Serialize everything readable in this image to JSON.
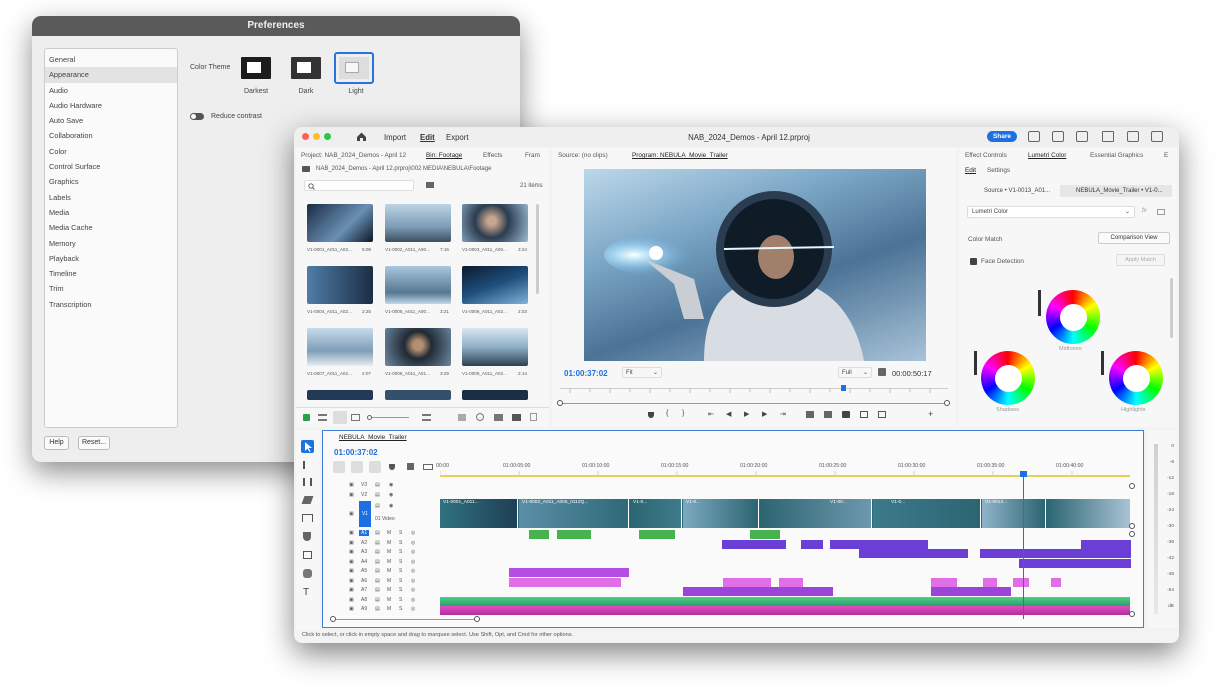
{
  "prefs": {
    "title": "Preferences",
    "categories": [
      "General",
      "Appearance",
      "Audio",
      "Audio Hardware",
      "Auto Save",
      "Collaboration",
      "Color",
      "Control Surface",
      "Graphics",
      "Labels",
      "Media",
      "Media Cache",
      "Memory",
      "Playback",
      "Timeline",
      "Trim",
      "Transcription"
    ],
    "selected": "Appearance",
    "color_theme_label": "Color Theme",
    "themes": [
      "Darkest",
      "Dark",
      "Light"
    ],
    "selected_theme": "Light",
    "reduce_contrast_label": "Reduce contrast",
    "help_label": "Help",
    "reset_label": "Reset..."
  },
  "menu": {
    "import": "Import",
    "edit": "Edit",
    "export": "Export"
  },
  "window_title": "NAB_2024_Demos - April 12.prproj",
  "share_label": "Share",
  "project": {
    "tabs": [
      "Project: NAB_2024_Demos - April 12",
      "Bin: Footage",
      "Effects",
      "Fram"
    ],
    "path": "NAB_2024_Demos - April 12.prproj\\002 MEDIA\\NEBULA\\Footage",
    "count": "21 items",
    "clips": [
      {
        "name": "V1-0001_A011_A02...",
        "dur": "5:08"
      },
      {
        "name": "V1-0002_A011_A00...",
        "dur": "7:16"
      },
      {
        "name": "V1-0003_A011_A00...",
        "dur": "3:24"
      },
      {
        "name": "V1-0004_A011_A02...",
        "dur": "2:25"
      },
      {
        "name": "V1-0005_A011_A00...",
        "dur": "3:21"
      },
      {
        "name": "V1-0006_A011_A02...",
        "dur": "2:03"
      },
      {
        "name": "V1-0007_A011_A02...",
        "dur": "2:07"
      },
      {
        "name": "V1-0008_A011_A01...",
        "dur": "3:29"
      },
      {
        "name": "V1-0009_A011_A02...",
        "dur": "2:14"
      }
    ]
  },
  "monitor": {
    "source_tab": "Source: (no clips)",
    "program_tab": "Program: NEBULA_Movie_Trailer",
    "timecode": "01:00:37:02",
    "fit": "Fit",
    "quality": "Full",
    "duration": "00:00:50:17"
  },
  "lumetri": {
    "tabs": [
      "Effect Controls",
      "Lumetri Color",
      "Essential Graphics",
      "E"
    ],
    "subtabs": [
      "Edit",
      "Settings"
    ],
    "source": "Source • V1-0013_A01...",
    "target": "NEBULA_Movie_Trailer • V1-0...",
    "effect": "Lumetri Color",
    "color_match": "Color Match",
    "comparison_view": "Comparison View",
    "face_detection": "Face Detection",
    "apply_match": "Apply Match",
    "wheels": [
      "Midtones",
      "Shadows",
      "Highlights"
    ]
  },
  "timeline": {
    "tab": "NEBULA_Movie_Trailer",
    "timecode": "01:00:37:02",
    "ruler": [
      "00:00",
      "01:00:05:00",
      "01:00:10:00",
      "01:00:15:00",
      "01:00:20:00",
      "01:00:25:00",
      "01:00:30:00",
      "01:00:35:00",
      "01:00:40:00"
    ],
    "video_tracks": [
      "V3",
      "V2",
      "V1"
    ],
    "video_name": "01 Video",
    "audio_tracks": [
      "A1",
      "A2",
      "A3",
      "A4",
      "A5",
      "A6",
      "A7",
      "A8",
      "A9"
    ],
    "video_clips": [
      "V1-0001_A011...",
      "V1-0002_A011_A005_0112Q...",
      "V1-0...",
      "V1-0...",
      "V1-00...",
      "V1-0...",
      "V1-0013..."
    ],
    "mute": "M",
    "solo": "S"
  },
  "meter": {
    "db": [
      "0",
      "-6",
      "-12",
      "-18",
      "-24",
      "-30",
      "-36",
      "-42",
      "-48",
      "-54",
      "dB"
    ]
  },
  "status_text": "Click to select, or click in empty space and drag to marquee select. Use Shift, Opt, and Cmd for other options."
}
